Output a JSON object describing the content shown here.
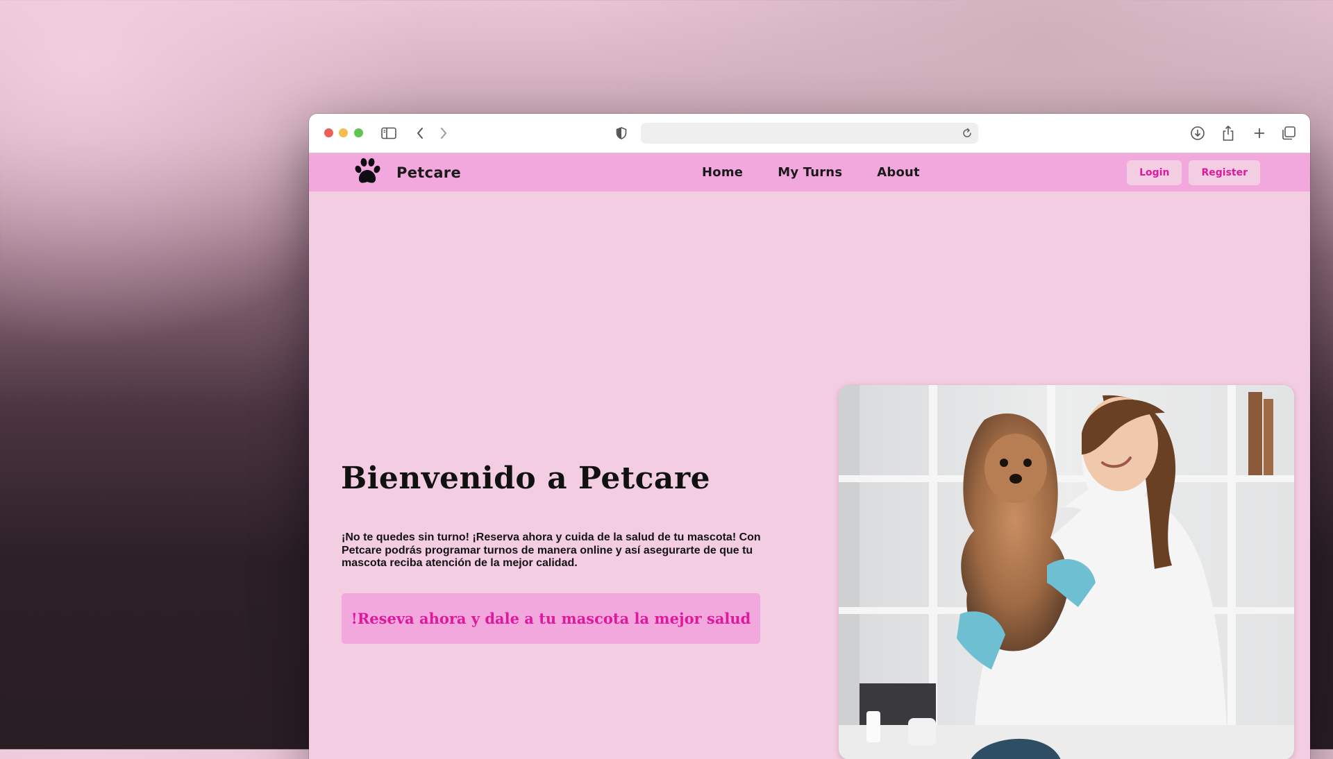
{
  "browser": {
    "icons": {
      "close": "close-dot",
      "minimize": "minimize-dot",
      "zoom": "zoom-dot",
      "sidebar": "sidebar-icon",
      "back": "chevron-left-icon",
      "forward": "chevron-right-icon",
      "shield": "shield-icon",
      "reload": "reload-icon",
      "download": "download-icon",
      "share": "share-icon",
      "new_tab": "plus-icon",
      "tabs": "tabs-overview-icon"
    },
    "address": ""
  },
  "site": {
    "brand": "Petcare",
    "logo_icon": "paw-icon",
    "nav": [
      "Home",
      "My Turns",
      "About"
    ],
    "login_label": "Login",
    "register_label": "Register"
  },
  "hero": {
    "title": "Bienvenido a Petcare",
    "text": "¡No te quedes sin turno! ¡Reserva ahora y cuida de la salud de tu mascota! Con Petcare podrás programar turnos de manera online y así asegurarte de que tu mascota reciba atención de la mejor calidad.",
    "cta_label": "!Reseva ahora y dale a tu mascota la mejor salud",
    "image": "veterinarian-holding-dog-photo"
  },
  "colors": {
    "nav_bg": "#f3a8dd",
    "page_bg": "#f3cde2",
    "accent": "#e0189b"
  }
}
